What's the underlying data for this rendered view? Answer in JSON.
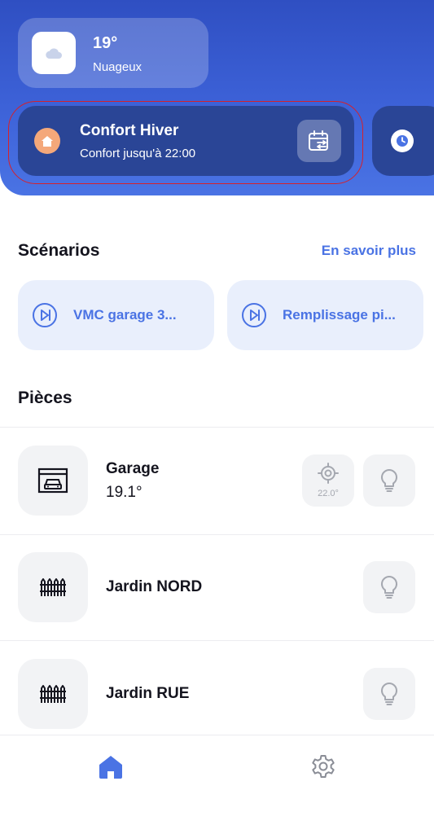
{
  "weather": {
    "temperature": "19°",
    "condition": "Nuageux",
    "icon": "cloud-icon"
  },
  "mode": {
    "title": "Confort Hiver",
    "subtitle": "Confort jusqu'à 22:00",
    "icon": "home-icon",
    "action_icon": "calendar-schedule-icon"
  },
  "next_card": {
    "icon": "clock-icon"
  },
  "scenarios": {
    "title": "Scénarios",
    "learn_more": "En savoir plus",
    "items": [
      {
        "label": "VMC garage 3...",
        "icon": "play-icon"
      },
      {
        "label": "Remplissage pi...",
        "icon": "play-icon"
      }
    ]
  },
  "rooms": {
    "title": "Pièces",
    "items": [
      {
        "name": "Garage",
        "temperature": "19.1°",
        "icon": "garage-icon",
        "target": "22.0°"
      },
      {
        "name": "Jardin NORD",
        "icon": "fence-icon"
      },
      {
        "name": "Jardin RUE",
        "icon": "fence-icon"
      }
    ]
  },
  "nav": {
    "items": [
      "home-icon",
      "settings-icon"
    ]
  },
  "colors": {
    "accent": "#4a73e4",
    "header": "#2f4fc2",
    "mode_card": "#2a4596",
    "home_badge": "#f4a87a",
    "highlight": "#d6212b"
  }
}
